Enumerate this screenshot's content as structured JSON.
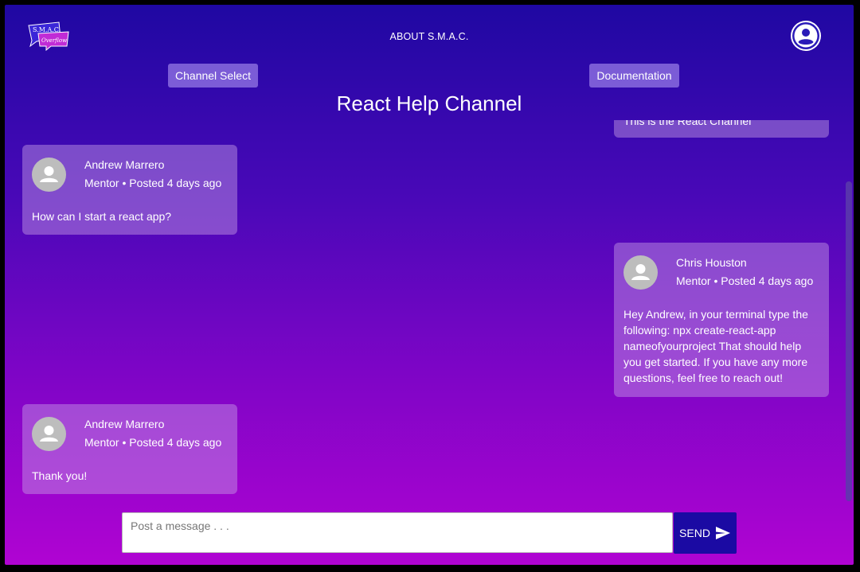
{
  "header": {
    "logo_line1": "S.M.A.C.",
    "logo_line2": "Overflow",
    "about_label": "ABOUT S.M.A.C.",
    "account_icon": "account-circle-icon"
  },
  "nav": {
    "channel_select_label": "Channel Select",
    "documentation_label": "Documentation"
  },
  "page_title": "React Help Channel",
  "messages": [
    {
      "partial_text": "This is the React Channel"
    },
    {
      "name": "Andrew Marrero",
      "meta": "Mentor • Posted 4 days ago",
      "body": "How can I start a react app?"
    },
    {
      "name": "Chris Houston",
      "meta": "Mentor • Posted 4 days ago",
      "body": "Hey Andrew, in your terminal type the following: npx create-react-app nameofyourproject That should help you get started. If you have any more questions, feel free to reach out!"
    },
    {
      "name": "Andrew Marrero",
      "meta": "Mentor • Posted 4 days ago",
      "body": "Thank you!"
    }
  ],
  "composer": {
    "placeholder": "Post a message . . .",
    "value": "",
    "send_label": "SEND",
    "send_icon": "send-icon"
  },
  "colors": {
    "gradient_top": "#1f08a2",
    "gradient_bottom": "#b004d2",
    "send_button": "#1b0aa3",
    "card": "rgba(200,160,230,0.45)"
  }
}
